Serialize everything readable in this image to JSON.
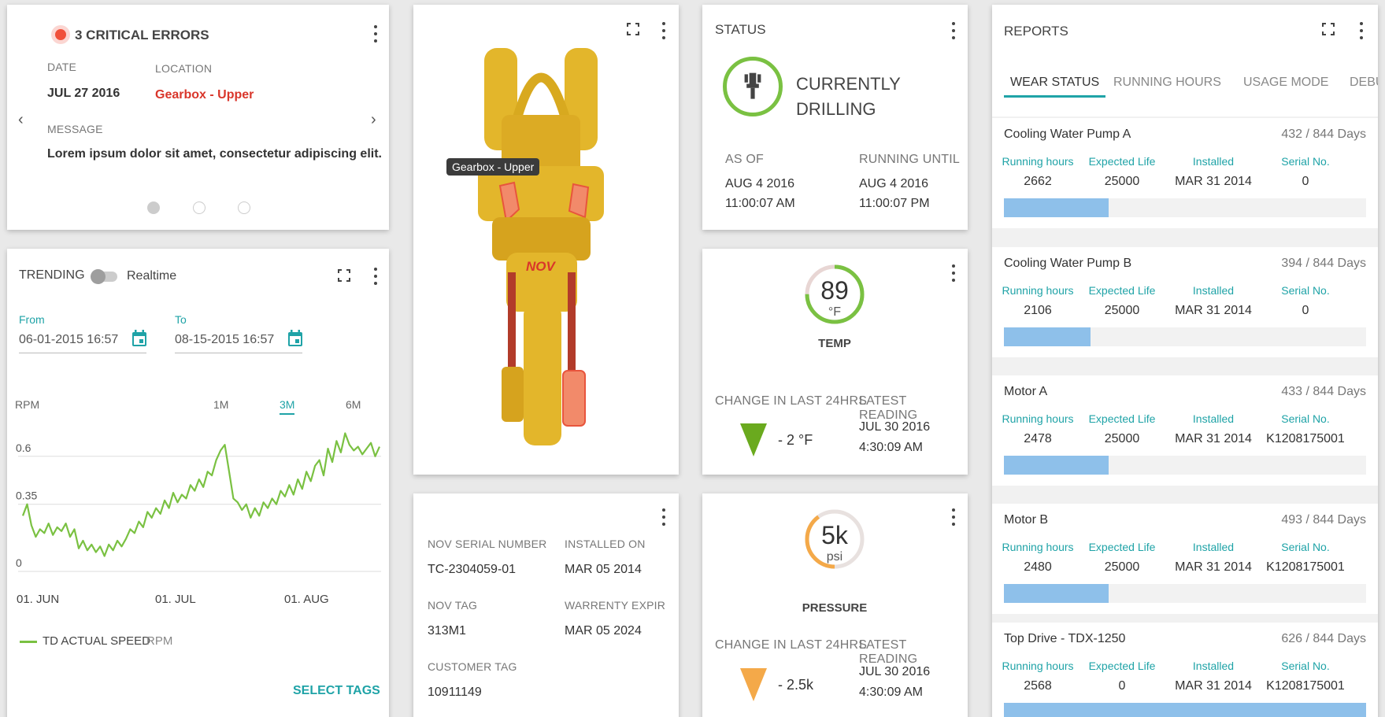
{
  "errors": {
    "title": "3 CRITICAL ERRORS",
    "date_label": "DATE",
    "date_value": "JUL 27 2016",
    "location_label": "LOCATION",
    "location_value": "Gearbox - Upper",
    "message_label": "MESSAGE",
    "message_value": "Lorem ipsum dolor sit amet, consectetur adipiscing elit.",
    "pages": 3,
    "active_page": 1
  },
  "trending": {
    "title": "TRENDING",
    "toggle_label": "Realtime",
    "toggle_on": false,
    "from_label": "From",
    "from_value": "06-01-2015 16:57",
    "to_label": "To",
    "to_value": "08-15-2015 16:57",
    "ranges": [
      "1M",
      "3M",
      "6M"
    ],
    "active_range": "3M",
    "legend_name": "TD ACTUAL SPEED",
    "legend_unit": "RPM",
    "select_tags": "SELECT TAGS"
  },
  "equipment": {
    "callout": "Gearbox - Upper",
    "brand": "NOV"
  },
  "details": {
    "serial_label": "NOV SERIAL NUMBER",
    "serial_value": "TC-2304059-01",
    "installed_label": "INSTALLED ON",
    "installed_value": "MAR 05 2014",
    "tag_label": "NOV TAG",
    "tag_value": "313M1",
    "warranty_label": "WARRENTY EXPIR",
    "warranty_value": "MAR 05 2024",
    "customer_label": "CUSTOMER TAG",
    "customer_value": "10911149"
  },
  "status": {
    "title": "STATUS",
    "state_line1": "CURRENTLY",
    "state_line2": "DRILLING",
    "asof_label": "AS OF",
    "asof_date": "AUG 4 2016",
    "asof_time": "11:00:07 AM",
    "until_label": "RUNNING UNTIL",
    "until_date": "AUG 4 2016",
    "until_time": "11:00:07 PM"
  },
  "temp": {
    "value": "89",
    "unit": "°F",
    "label": "TEMP",
    "gauge_fraction": 0.75,
    "change_label": "CHANGE IN LAST 24HRS",
    "change_value": "- 2 °F",
    "latest_label": "LATEST READING",
    "latest_date": "JUL 30 2016",
    "latest_time": "4:30:09 AM",
    "color": "#7ac142"
  },
  "pressure": {
    "value": "5k",
    "unit": "psi",
    "label": "PRESSURE",
    "gauge_fraction": 0.4,
    "change_label": "CHANGE IN LAST 24HRS",
    "change_value": "- 2.5k",
    "latest_label": "LATEST READING",
    "latest_date": "JUL 30 2016",
    "latest_time": "4:30:09 AM",
    "color": "#f4a949"
  },
  "reports": {
    "title": "REPORTS",
    "tabs": [
      "WEAR STATUS",
      "RUNNING HOURS",
      "USAGE MODE",
      "DEBUG"
    ],
    "active_tab": 0,
    "headers": [
      "Running hours",
      "Expected Life",
      "Installed",
      "Serial No."
    ],
    "items": [
      {
        "name": "Cooling Water Pump A",
        "days": "432 / 844 Days",
        "running": "2662",
        "expected": "25000",
        "installed": "MAR 31 2014",
        "serial": "0",
        "fraction": 0.286
      },
      {
        "name": "Cooling Water Pump B",
        "days": "394 / 844 Days",
        "running": "2106",
        "expected": "25000",
        "installed": "MAR 31 2014",
        "serial": "0",
        "fraction": 0.235
      },
      {
        "name": "Motor A",
        "days": "433 / 844 Days",
        "running": "2478",
        "expected": "25000",
        "installed": "MAR 31 2014",
        "serial": "K1208175001",
        "fraction": 0.286
      },
      {
        "name": "Motor B",
        "days": "493 / 844 Days",
        "running": "2480",
        "expected": "25000",
        "installed": "MAR 31 2014",
        "serial": "K1208175001",
        "fraction": 0.288
      },
      {
        "name": "Top Drive - TDX-1250",
        "days": "626 / 844 Days",
        "running": "2568",
        "expected": "0",
        "installed": "MAR 31 2014",
        "serial": "K1208175001",
        "fraction": 1.0
      }
    ]
  },
  "chart_data": {
    "type": "line",
    "title": "",
    "ylabel": "RPM",
    "xlabel": "",
    "x_ticks": [
      "01. JUN",
      "01. JUL",
      "01. AUG"
    ],
    "y_ticks": [
      0,
      0.35,
      0.6
    ],
    "ylim": [
      0,
      0.8
    ],
    "x_range": [
      "2015-06-01",
      "2015-08-15"
    ],
    "grid": true,
    "legend": "bottom-left",
    "series": [
      {
        "name": "TD ACTUAL SPEED",
        "color": "#7ac142",
        "values": [
          0.29,
          0.35,
          0.24,
          0.18,
          0.22,
          0.2,
          0.25,
          0.19,
          0.23,
          0.21,
          0.25,
          0.18,
          0.22,
          0.12,
          0.16,
          0.11,
          0.14,
          0.1,
          0.13,
          0.08,
          0.14,
          0.11,
          0.16,
          0.13,
          0.17,
          0.22,
          0.2,
          0.26,
          0.23,
          0.31,
          0.28,
          0.33,
          0.3,
          0.37,
          0.33,
          0.41,
          0.36,
          0.4,
          0.38,
          0.45,
          0.42,
          0.48,
          0.44,
          0.52,
          0.5,
          0.58,
          0.63,
          0.66,
          0.52,
          0.38,
          0.36,
          0.32,
          0.35,
          0.28,
          0.33,
          0.29,
          0.36,
          0.33,
          0.38,
          0.35,
          0.42,
          0.39,
          0.45,
          0.4,
          0.48,
          0.43,
          0.52,
          0.47,
          0.55,
          0.58,
          0.5,
          0.64,
          0.57,
          0.68,
          0.62,
          0.72,
          0.66,
          0.63,
          0.65,
          0.61,
          0.64,
          0.67,
          0.6,
          0.65
        ]
      }
    ]
  }
}
